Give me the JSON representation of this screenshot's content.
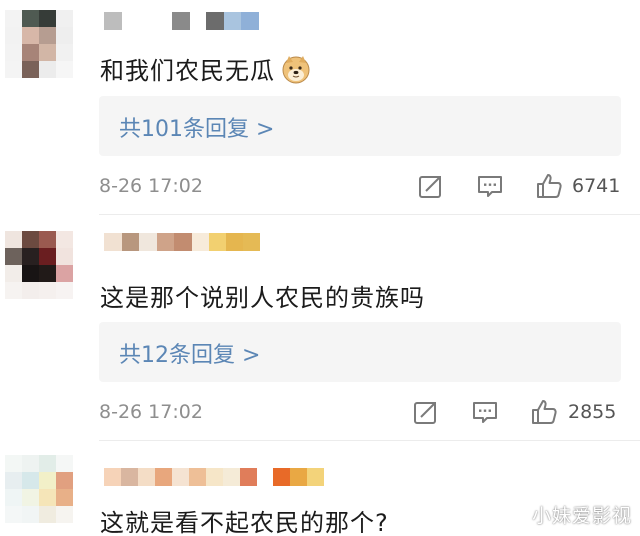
{
  "comments": [
    {
      "text": "和我们农民无瓜",
      "emoji": "doge-emoji",
      "reply_label": "共101条回复 >",
      "timestamp": "8-26 17:02",
      "like_count": "6741"
    },
    {
      "text": "这是那个说别人农民的贵族吗",
      "reply_label": "共12条回复 >",
      "timestamp": "8-26 17:02",
      "like_count": "2855"
    },
    {
      "text": "这就是看不起农民的那个?"
    }
  ],
  "icons": {
    "repost": "repost-icon",
    "comment": "comment-icon",
    "like": "thumbs-up-icon"
  },
  "colors": {
    "reply_link": "#5b86b5",
    "timestamp": "#8e8e8e",
    "reply_bg": "#f5f5f5"
  },
  "watermark": "小妹爱影视"
}
